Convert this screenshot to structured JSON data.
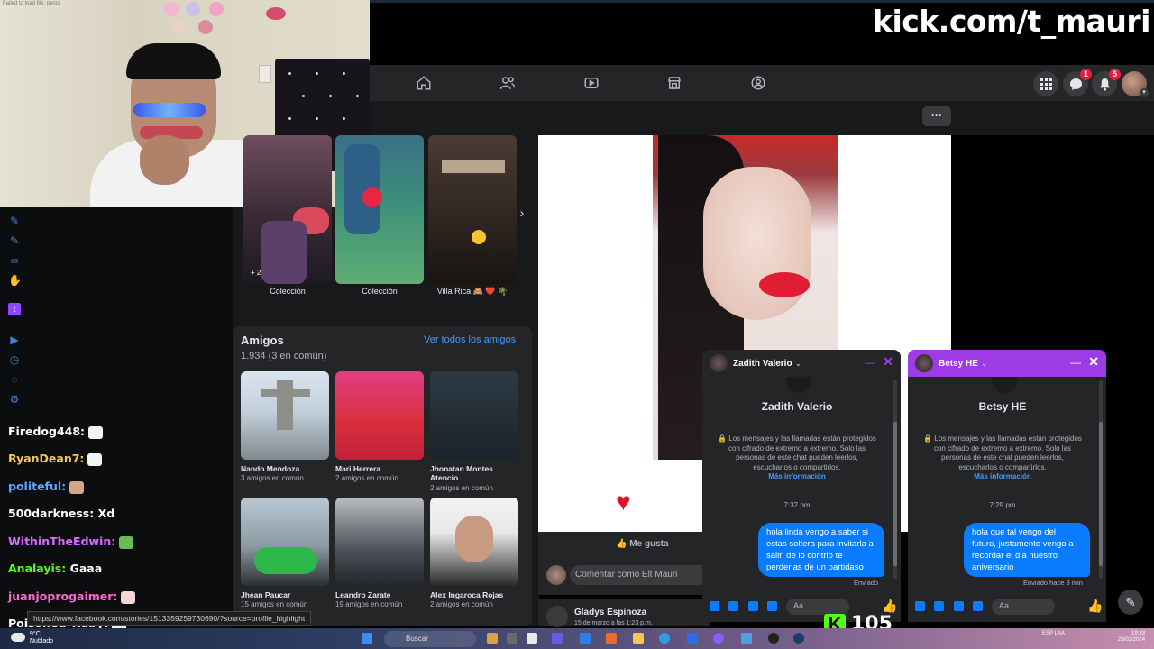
{
  "overlay": {
    "kick_url": "kick.com/t_mauri",
    "viewer_count": "105",
    "cam_error": "Failed to load file: pencil"
  },
  "facebook": {
    "nav_icons": [
      "home-icon",
      "friends-icon",
      "watch-icon",
      "marketplace-icon",
      "groups-icon"
    ],
    "menu_badge_messenger": "1",
    "menu_badge_notifications": "5",
    "more_label": "···",
    "collections": [
      {
        "label": "Colección"
      },
      {
        "label": "Colección"
      },
      {
        "label": "Villa Rica 🙈 ❤️ 🌴"
      }
    ],
    "collection_plus": "+ 2",
    "amigos": {
      "title": "Amigos",
      "count": "1.934 (3 en común)",
      "see_all": "Ver todos los amigos",
      "friends": [
        {
          "name": "Nando Mendoza",
          "mutual": "3 amigos en común"
        },
        {
          "name": "Mari Herrera",
          "mutual": "2 amigos en común"
        },
        {
          "name": "Jhonatan Montes Atencio",
          "mutual": "2 amigos en común"
        },
        {
          "name": "Jhean Paucar",
          "mutual": "15 amigos en común"
        },
        {
          "name": "Leandro Zarate",
          "mutual": "19 amigos en común"
        },
        {
          "name": "Alex Ingaroca Rojas",
          "mutual": "2 amigos en común"
        }
      ]
    },
    "post": {
      "like_label": "Me gusta",
      "comment_placeholder": "Comentar como Elt Mauri",
      "next_post_name": "Gladys Espinoza",
      "next_post_date": "15 de marzo a las 1:23 p.m."
    },
    "chats": [
      {
        "header_name": "Zadith Valerio",
        "title_name": "Zadith Valerio",
        "e2ee_text": "🔒 Los mensajes y las llamadas están protegidos con cifrado de extremo a extremo. Solo las personas de este chat pueden leerlos, escucharlos o compartirlos.",
        "e2ee_link": "Más información",
        "time": "7:32 pm",
        "message": "hola linda vengo a saber si estas soltera para invitarla a salir, de lo contrio te perderias de un partidaso",
        "status": "Enviado",
        "input_placeholder": "Aa"
      },
      {
        "header_name": "Betsy HE",
        "title_name": "Betsy HE",
        "e2ee_text": "🔒 Los mensajes y las llamadas están protegidos con cifrado de extremo a extremo. Solo las personas de este chat pueden leerlos, escucharlos o compartirlos.",
        "e2ee_link": "Más información",
        "time": "7:29 pm",
        "message": "hola que tal vengo del futuro, justamente vengo a recordar el dia nuestro aniversario",
        "status": "Enviado hace 3 min",
        "input_placeholder": "Aa"
      }
    ]
  },
  "stream_chat": [
    {
      "user": "Firedog448:",
      "text": "",
      "color": "#ffffff"
    },
    {
      "user": "RyanDean7:",
      "text": "",
      "color": "#f2c94c"
    },
    {
      "user": "politeful:",
      "text": "",
      "color": "#5aa7ff"
    },
    {
      "user": "500darkness:",
      "text": "Xd",
      "color": "#ffffff"
    },
    {
      "user": "WithinTheEdwin:",
      "text": "",
      "color": "#d86bff"
    },
    {
      "user": "Analayis:",
      "text": "Gaaa",
      "color": "#53fc18"
    },
    {
      "user": "juanjoprogaimer:",
      "text": "",
      "color": "#ff66cc"
    },
    {
      "user": "Poisoned_Ruby:",
      "text": "",
      "color": "#ffffff"
    }
  ],
  "status_url": "https://www.facebook.com/stories/1513359259730690/?source=profile_highlight",
  "taskbar": {
    "weather_temp": "9°C",
    "weather_desc": "Nublado",
    "search_label": "Buscar",
    "lang": "ESP LAA",
    "time": "19:33",
    "date": "23/03/2024"
  },
  "colors": {
    "fb_dark": "#18191a",
    "fb_card": "#242526",
    "messenger_blue": "#0a7cff",
    "chat_purple": "#9d3be6",
    "kick_green": "#53fc18"
  }
}
